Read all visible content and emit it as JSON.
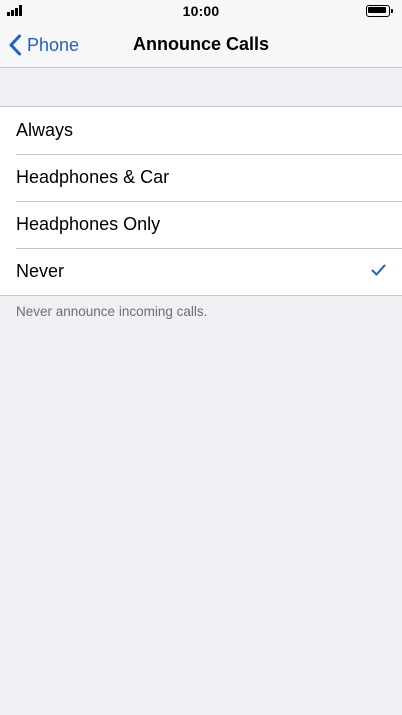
{
  "status_bar": {
    "time": "10:00",
    "signal_icon": "cellular-signal-icon",
    "battery_icon": "battery-icon"
  },
  "nav": {
    "back_label": "Phone",
    "back_icon": "chevron-left-icon",
    "title": "Announce Calls"
  },
  "options": [
    {
      "label": "Always",
      "selected": false
    },
    {
      "label": "Headphones & Car",
      "selected": false
    },
    {
      "label": "Headphones Only",
      "selected": false
    },
    {
      "label": "Never",
      "selected": true
    }
  ],
  "footer": {
    "note": "Never announce incoming calls."
  },
  "colors": {
    "accent": "#1d5fd3",
    "background": "#efeff4",
    "separator": "#c8c7cc",
    "footer_text": "#6d6d72"
  }
}
